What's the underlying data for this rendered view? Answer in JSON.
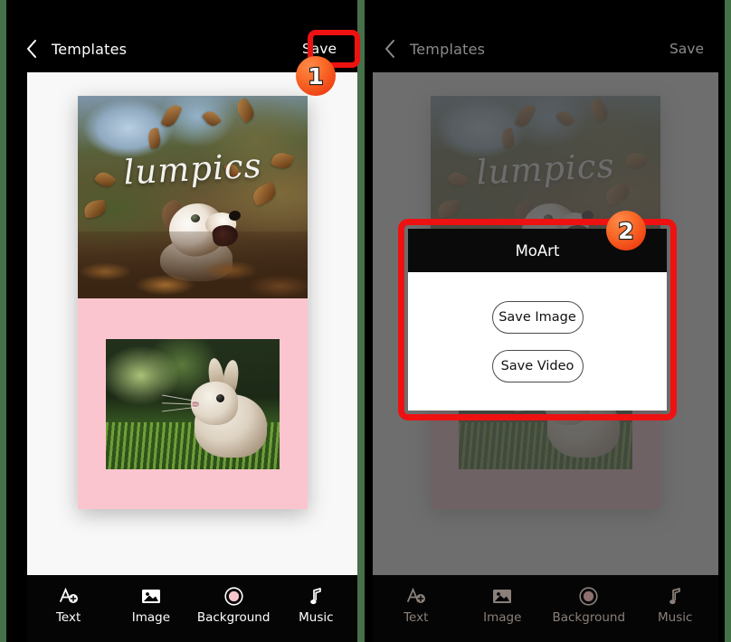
{
  "theme": {
    "outer_background": "#46704a",
    "phone_background": "#000000",
    "canvas_background": "#f8f8f8",
    "template_pink": "#fbc5cf",
    "annotation_red": "#ee1111",
    "badge_orange": "#f96a28",
    "dim_overlay": "rgba(70,70,70,0.78)"
  },
  "left_phone": {
    "appbar": {
      "back_icon": "chevron-left-icon",
      "title": "Templates",
      "action_label": "Save"
    },
    "template": {
      "watermark_text": "lumpics",
      "top_photo_description": "dog in autumn leaves",
      "bottom_photo_description": "rabbit in grass",
      "lower_background_color": "#fbc5cf"
    },
    "bottom_nav": [
      {
        "icon": "text-add-icon",
        "label": "Text"
      },
      {
        "icon": "image-icon",
        "label": "Image"
      },
      {
        "icon": "background-circle-icon",
        "label": "Background"
      },
      {
        "icon": "music-note-icon",
        "label": "Music"
      }
    ]
  },
  "right_phone": {
    "appbar": {
      "back_icon": "chevron-left-icon",
      "title": "Templates",
      "action_label": "Save"
    },
    "template": {
      "watermark_text": "lumpics"
    },
    "dialog": {
      "title": "MoArt",
      "buttons": [
        {
          "label": "Save Image"
        },
        {
          "label": "Save Video"
        }
      ]
    },
    "bottom_nav": [
      {
        "icon": "text-add-icon",
        "label": "Text"
      },
      {
        "icon": "image-icon",
        "label": "Image"
      },
      {
        "icon": "background-circle-icon",
        "label": "Background"
      },
      {
        "icon": "music-note-icon",
        "label": "Music"
      }
    ]
  },
  "annotations": {
    "badges": [
      {
        "number": "1"
      },
      {
        "number": "2"
      }
    ]
  }
}
